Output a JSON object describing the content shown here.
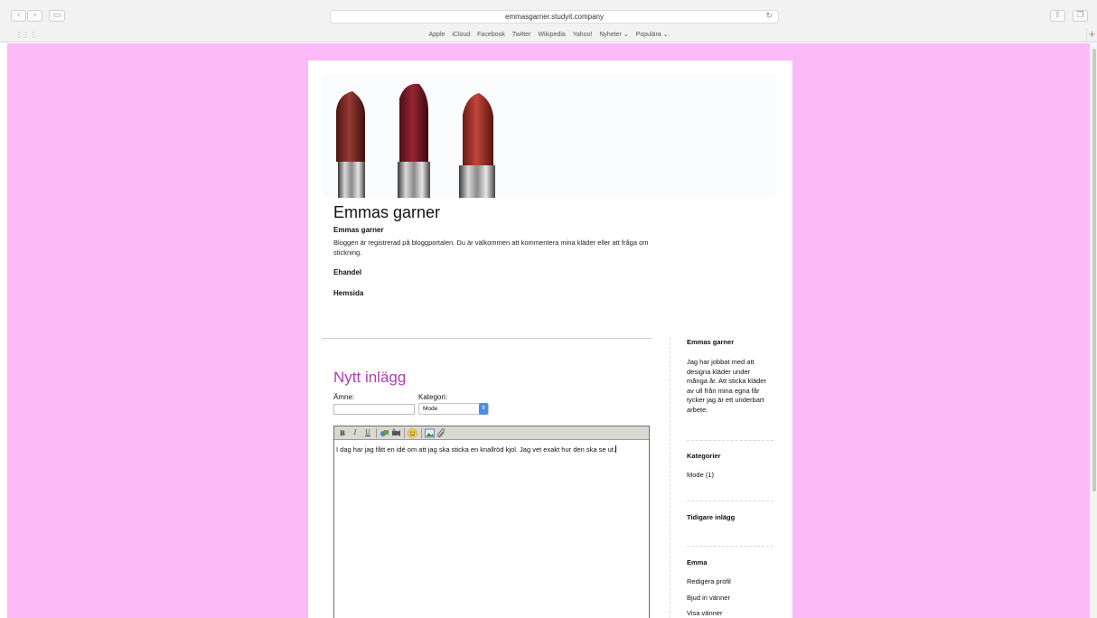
{
  "browser": {
    "url": "emmasgarner.studyit.company",
    "favorites": [
      {
        "label": "Apple"
      },
      {
        "label": "iCloud"
      },
      {
        "label": "Facebook"
      },
      {
        "label": "Twitter"
      },
      {
        "label": "Wikipedia"
      },
      {
        "label": "Yahoo!"
      },
      {
        "label": "Nyheter ⌄"
      },
      {
        "label": "Populära ⌄"
      }
    ]
  },
  "blog": {
    "title": "Emmas garner",
    "intro_heading": "Emmas garner",
    "intro_text": "Bloggen är registrerad på bloggportalen. Du är välkommen att kommentera mina kläder eller att fråga om stickning.",
    "link_ehandel": "Ehandel",
    "link_hemsida": "Hemsida"
  },
  "new_post": {
    "heading": "Nytt inlägg",
    "subject_label": "Ämne:",
    "subject_value": "",
    "category_label": "Kategori:",
    "category_value": "Mode",
    "toolbar": {
      "bold": "B",
      "italic": "I",
      "underline": "U"
    },
    "body_text": "I dag har jag fått en idé om att jag ska sticka en knallröd kjol. Jag vet exakt hur den ska se ut."
  },
  "sidebar": {
    "about_heading": "Emmas garner",
    "about_text": "Jag har jobbat med att designa kläder under många år. Att sticka kläder av ull från mina egna får tycker jag är ett underbart arbete.",
    "categories_heading": "Kategorier",
    "categories": [
      {
        "label": "Mode (1)"
      }
    ],
    "archive_heading": "Tidigare inlägg",
    "user_heading": "Emma",
    "user_links": [
      {
        "label": "Redigera profil"
      },
      {
        "label": "Bjud in vänner"
      },
      {
        "label": "Visa vänner"
      }
    ]
  },
  "colors": {
    "page_background": "#fbb9f7",
    "post_heading": "#b43bb4",
    "select_arrow": "#4a8ee8"
  }
}
